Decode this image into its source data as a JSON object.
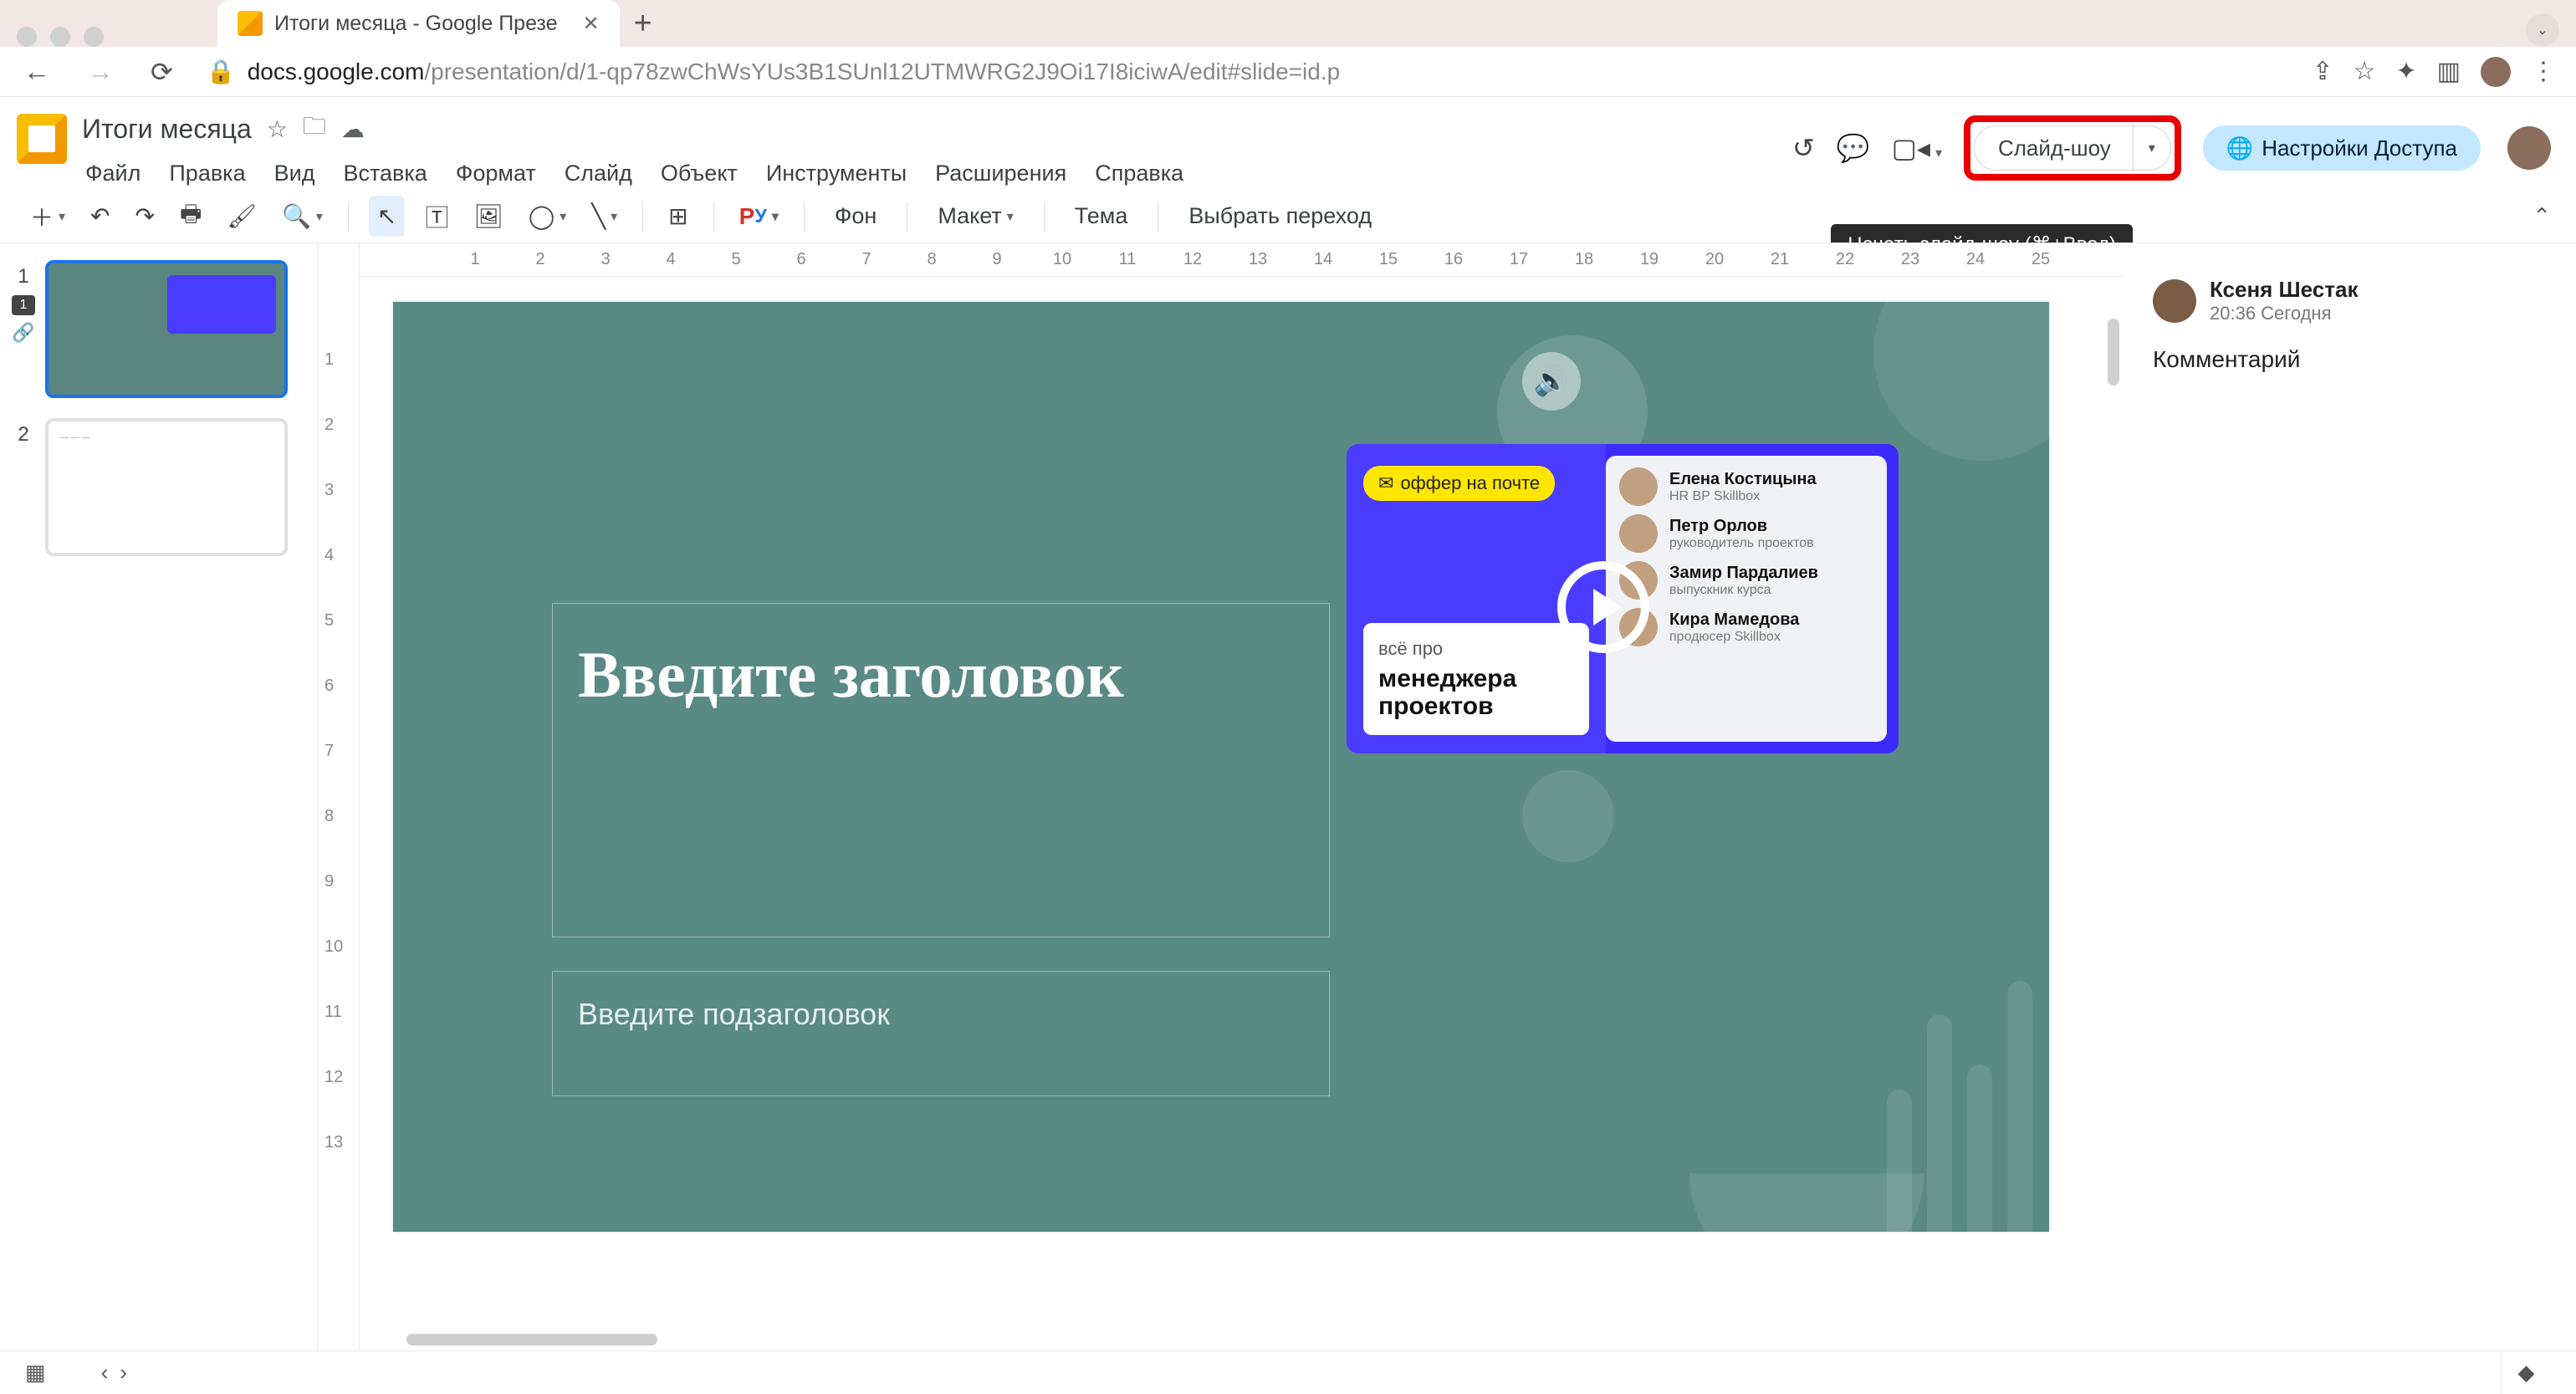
{
  "browser": {
    "tab_title": "Итоги месяца - Google Презе",
    "url_domain": "docs.google.com",
    "url_path": "/presentation/d/1-qp78zwChWsYUs3B1SUnl12UTMWRG2J9Oi17I8iciwA/edit#slide=id.p"
  },
  "header": {
    "doc_title": "Итоги месяца",
    "menus": [
      "Файл",
      "Правка",
      "Вид",
      "Вставка",
      "Формат",
      "Слайд",
      "Объект",
      "Инструменты",
      "Расширения",
      "Справка"
    ],
    "slideshow_label": "Слайд-шоу",
    "share_label": "Настройки Доступа",
    "tooltip": "Начать слайд-шоу (⌘+Ввод)"
  },
  "toolbar": {
    "spellcheck_label": "Р",
    "spellcheck_sub": "У",
    "bg_label": "Фон",
    "layout_label": "Макет",
    "theme_label": "Тема",
    "transition_label": "Выбрать переход"
  },
  "thumbnails": [
    {
      "num": "1",
      "active": true
    },
    {
      "num": "2",
      "active": false
    }
  ],
  "slide": {
    "title_placeholder": "Введите заголовок",
    "subtitle_placeholder": "Введите подзаголовок",
    "offer_pill": "оффер на почте",
    "video_super": "всё про",
    "video_title": "менеджера проектов",
    "speakers": [
      {
        "name": "Елена Костицына",
        "role": "HR BP Skillbox"
      },
      {
        "name": "Петр Орлов",
        "role": "руководитель проектов"
      },
      {
        "name": "Замир Пардалиев",
        "role": "выпускник курса"
      },
      {
        "name": "Кира Мамедова",
        "role": "продюсер Skillbox"
      }
    ]
  },
  "ruler_h": [
    "",
    "1",
    "2",
    "3",
    "4",
    "5",
    "6",
    "7",
    "8",
    "9",
    "10",
    "11",
    "12",
    "13",
    "14",
    "15",
    "16",
    "17",
    "18",
    "19",
    "20",
    "21",
    "22",
    "23",
    "24",
    "25"
  ],
  "ruler_v": [
    "",
    "1",
    "2",
    "3",
    "4",
    "5",
    "6",
    "7",
    "8",
    "9",
    "10",
    "11",
    "12",
    "13"
  ],
  "comments": {
    "author": "Ксеня Шестак",
    "time": "20:36 Сегодня",
    "body": "Комментарий"
  }
}
